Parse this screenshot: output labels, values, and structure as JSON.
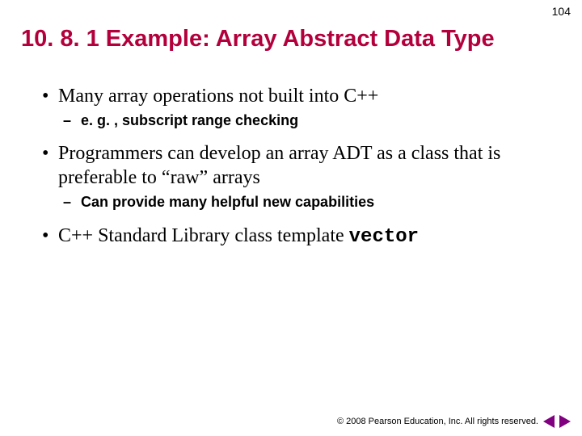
{
  "pageNumber": "104",
  "title": "10. 8. 1 Example: Array Abstract Data Type",
  "bullets": {
    "b1": "Many array operations not built into C++",
    "b1_sub": "e. g. , subscript range checking",
    "b2": "Programmers can develop an array ADT as a class that is preferable to “raw” arrays",
    "b2_sub": "Can provide many helpful new capabilities",
    "b3_prefix": "C++ Standard Library class template ",
    "b3_code": "vector"
  },
  "footer": {
    "copyright": "© 2008 Pearson Education, Inc. All rights reserved."
  }
}
